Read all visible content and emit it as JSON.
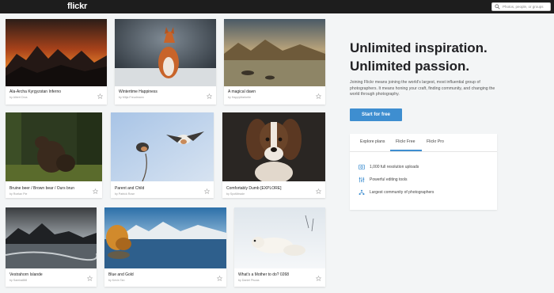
{
  "header": {
    "logo": "flickr",
    "search_placeholder": "Photos, people, or groups"
  },
  "photos": [
    {
      "title": "Ala-Archa Kyrgyzstan Inferno",
      "by": "by Albert Dros"
    },
    {
      "title": "Wintertime Happiness",
      "by": "by Mitja Freudmann"
    },
    {
      "title": "A magical dawn",
      "by": "by HappyMarketle"
    },
    {
      "title": "Bruine beer / Brown bear / Ours brun",
      "by": "by Roelan Pie"
    },
    {
      "title": "Parent and Child",
      "by": "by Patrick Rose"
    },
    {
      "title": "Comfortably Dumb [EXPLORE]",
      "by": "by SpotMeade"
    },
    {
      "title": "Vestrahorn Islande",
      "by": "by Samira888"
    },
    {
      "title": "Blue and Gold",
      "by": "by Kevin Tan"
    },
    {
      "title": "What's a Mother to do? 0268",
      "by": "by Daniel Piscas"
    }
  ],
  "promo": {
    "headline1": "Unlimited inspiration.",
    "headline2": "Unlimited passion.",
    "description": "Joining Flickr means joining the world's largest, most influential group of photographers. It means honing your craft, finding community, and changing the world through photography.",
    "cta": "Start for free"
  },
  "plans": {
    "tabs": [
      "Explore plans",
      "Flickr Free",
      "Flickr Pro"
    ],
    "active_tab": "Flickr Free",
    "features": [
      "1,000 full resolution uploads",
      "Powerful editing tools",
      "Largest community of photographers"
    ]
  },
  "colors": {
    "accent": "#3e8ed0",
    "topbar": "#1d1d1d",
    "background": "#f3f5f6"
  }
}
